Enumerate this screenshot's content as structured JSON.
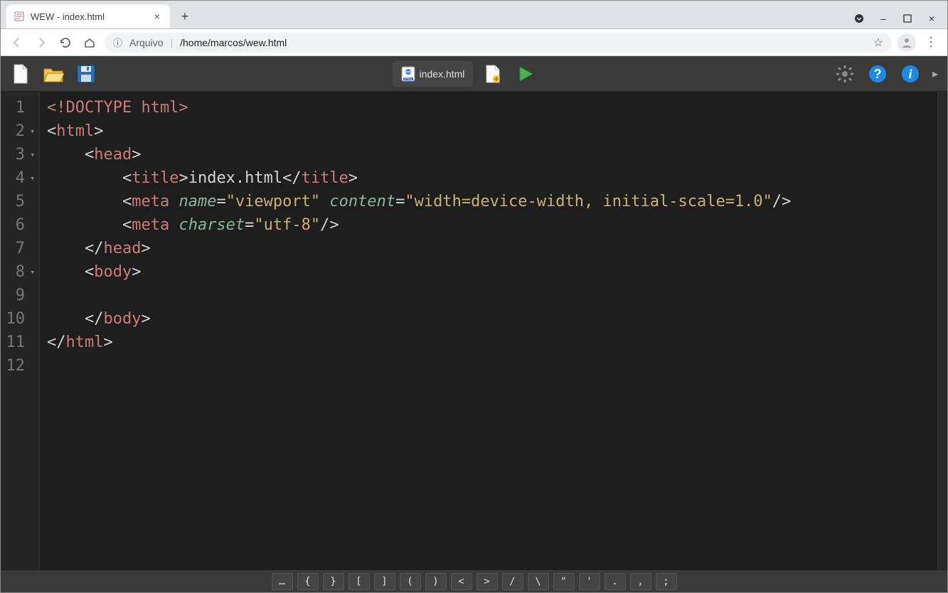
{
  "window": {
    "tab_title": "WEW - index.html",
    "minimize": "–",
    "maximize": "□",
    "close": "×"
  },
  "addressbar": {
    "scheme_label": "Arquivo",
    "separator": "|",
    "path": "/home/marcos/wew.html"
  },
  "toolbar": {
    "file_tab_label": "index.html"
  },
  "editor": {
    "lines": [
      {
        "n": "1",
        "fold": false
      },
      {
        "n": "2",
        "fold": true
      },
      {
        "n": "3",
        "fold": true
      },
      {
        "n": "4",
        "fold": true
      },
      {
        "n": "5",
        "fold": false
      },
      {
        "n": "6",
        "fold": false
      },
      {
        "n": "7",
        "fold": false
      },
      {
        "n": "8",
        "fold": true
      },
      {
        "n": "9",
        "fold": false
      },
      {
        "n": "10",
        "fold": false
      },
      {
        "n": "11",
        "fold": false
      },
      {
        "n": "12",
        "fold": false
      }
    ],
    "tokens": {
      "l1_doctype": "<!DOCTYPE html>",
      "l2_open_html_lt": "<",
      "l2_open_html_name": "html",
      "l2_open_html_gt": ">",
      "l3_open_head_lt": "<",
      "l3_open_head_name": "head",
      "l3_open_head_gt": ">",
      "l4_open_title_lt": "<",
      "l4_title": "title",
      "l4_open_title_gt": ">",
      "l4_title_text": "index.html",
      "l4_close_title_lt": "</",
      "l4_close_title_gt": ">",
      "l5_open_meta_lt": "<",
      "l5_meta": "meta",
      "l5_attr_name": "name",
      "l5_eq1": "=",
      "l5_val_name": "\"viewport\"",
      "l5_attr_content": "content",
      "l5_eq2": "=",
      "l5_val_content": "\"width=device-width, initial-scale=1.0\"",
      "l5_selfclose": "/>",
      "l6_open_meta_lt": "<",
      "l6_meta": "meta",
      "l6_attr_charset": "charset",
      "l6_eq": "=",
      "l6_val_charset": "\"utf-8\"",
      "l6_selfclose": "/>",
      "l7_close_head_lt": "</",
      "l7_head": "head",
      "l7_close_head_gt": ">",
      "l8_open_body_lt": "<",
      "l8_body": "body",
      "l8_open_body_gt": ">",
      "l9_blank": "",
      "l10_close_body_lt": "</",
      "l10_body": "body",
      "l10_close_body_gt": ">",
      "l11_close_html_lt": "</",
      "l11_html": "html",
      "l11_close_html_gt": ">"
    }
  },
  "symbols": [
    "…",
    "{",
    "}",
    "[",
    "]",
    "(",
    ")",
    "<",
    ">",
    "/",
    "\\",
    "\"",
    "'",
    ".",
    ",",
    ";"
  ]
}
